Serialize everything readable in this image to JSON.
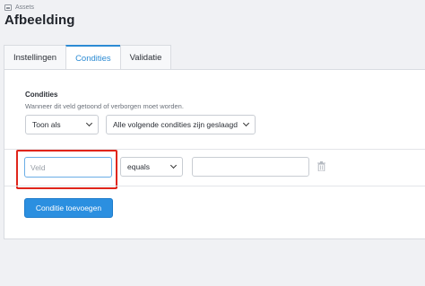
{
  "breadcrumb": {
    "label": "Assets",
    "icon": "image-icon"
  },
  "page": {
    "title": "Afbeelding"
  },
  "tabs": [
    {
      "label": "Instellingen",
      "active": false
    },
    {
      "label": "Condities",
      "active": true
    },
    {
      "label": "Validatie",
      "active": false
    }
  ],
  "conditions": {
    "label": "Condities",
    "description": "Wanneer dit veld getoond of verborgen moet worden.",
    "show_select": "Toon als",
    "match_select": "Alle volgende condities zijn geslaagd",
    "row": {
      "field_placeholder": "Veld",
      "operator": "equals",
      "value": ""
    },
    "add_button": "Conditie toevoegen"
  },
  "colors": {
    "accent": "#2b8fe0",
    "highlight": "#e0251b"
  }
}
